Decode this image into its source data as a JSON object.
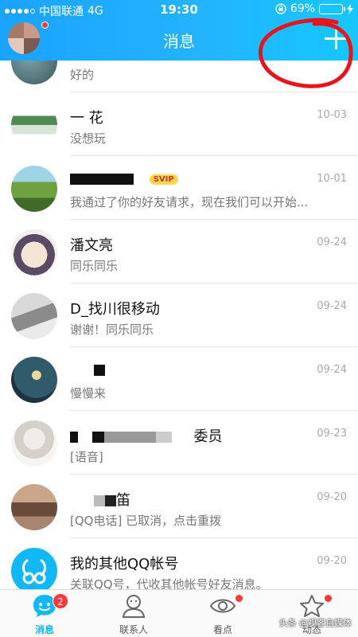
{
  "status_bar": {
    "carrier": "中国联通",
    "network": "4G",
    "time": "19:30",
    "battery": "69%",
    "battery_level": 0.69
  },
  "header": {
    "title": "消息"
  },
  "conversations": [
    {
      "name": "",
      "preview": "好的",
      "time": ""
    },
    {
      "name": "一 花",
      "preview": "没想玩",
      "time": "10-03"
    },
    {
      "name": "",
      "badge": "SVIP",
      "preview": "我通过了你的好友请求，现在我们可以开始...",
      "time": "10-01"
    },
    {
      "name": "潘文亮",
      "preview": "同乐同乐",
      "time": "09-24"
    },
    {
      "name": "D_找川很移动",
      "preview": "谢谢！同乐同乐",
      "time": "09-24"
    },
    {
      "name": "",
      "preview": "慢慢来",
      "time": "09-24"
    },
    {
      "name": "委员",
      "preview": "[语音]",
      "time": "09-23"
    },
    {
      "name": "笛",
      "preview": "[QQ电话] 已取消，点击重拨",
      "time": "09-20"
    },
    {
      "name": "我的其他QQ帐号",
      "preview": "关联QQ号，代收其他帐号好友消息。",
      "time": "09-20"
    }
  ],
  "tabbar": {
    "tabs": [
      {
        "label": "消息",
        "badge": "2"
      },
      {
        "label": "联系人"
      },
      {
        "label": "看点"
      },
      {
        "label": "动态"
      }
    ]
  },
  "watermark": "头条 @视客自媒体",
  "colors": {
    "accent": "#12b7f5",
    "badge": "#f43b3b",
    "annotation": "#e8141c"
  }
}
